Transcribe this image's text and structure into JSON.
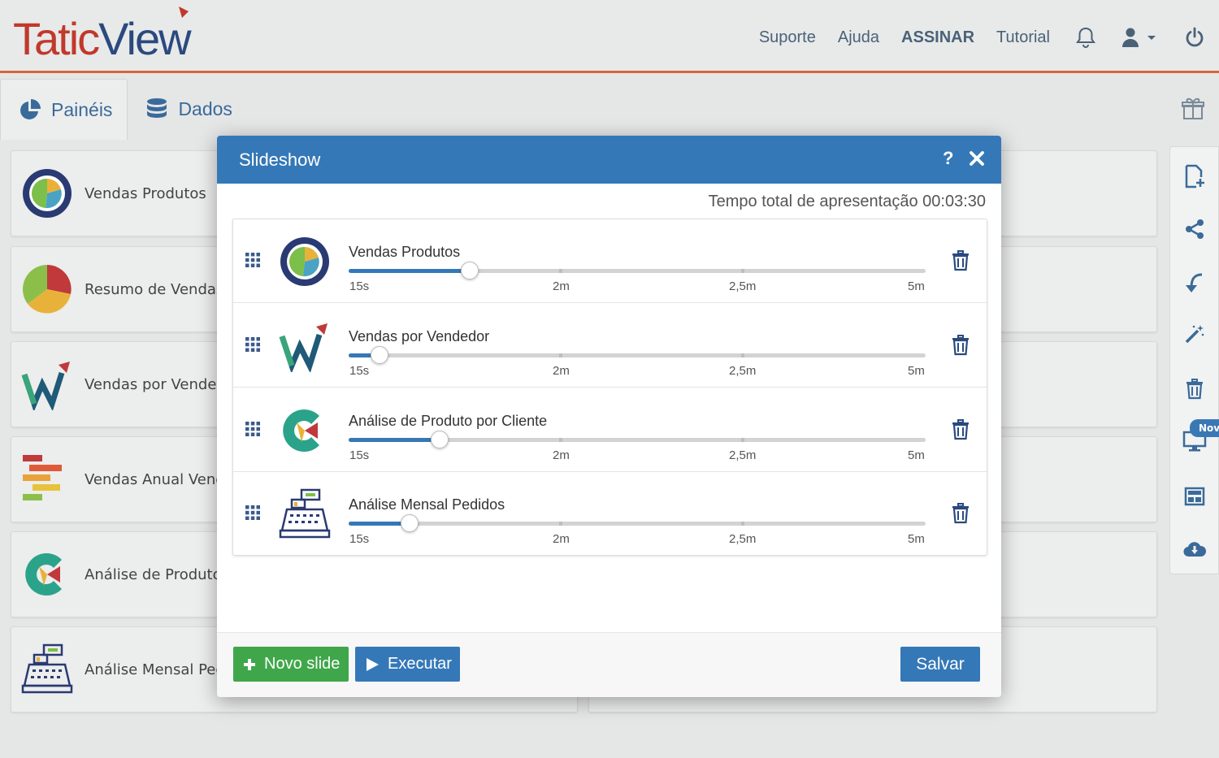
{
  "header": {
    "logo_part1": "Tatic",
    "logo_part2": "View",
    "nav": {
      "suporte": "Suporte",
      "ajuda": "Ajuda",
      "assinar": "ASSINAR",
      "tutorial": "Tutorial"
    }
  },
  "tabs": {
    "paineis": "Painéis",
    "dados": "Dados"
  },
  "cards": [
    "Vendas Produtos",
    "Resumo de Vendas",
    "Vendas por Vendedo",
    "Vendas Anual Vende",
    "Análise de Produto p",
    "Análise Mensal Pedid"
  ],
  "toolbar": {
    "new_badge": "Nov"
  },
  "modal": {
    "title": "Slideshow",
    "help": "?",
    "total_time": "Tempo total de apresentação 00:03:30",
    "slides": [
      {
        "title": "Vendas Produtos",
        "duration_fraction": 0.21
      },
      {
        "title": "Vendas por Vendedor",
        "duration_fraction": 0.053
      },
      {
        "title": "Análise de Produto por Cliente",
        "duration_fraction": 0.158
      },
      {
        "title": "Análise Mensal Pedidos",
        "duration_fraction": 0.105
      }
    ],
    "scale_labels": [
      "15s",
      "2m",
      "2,5m",
      "5m"
    ],
    "buttons": {
      "new_slide": "Novo slide",
      "run": "Executar",
      "save": "Salvar"
    }
  },
  "colors": {
    "accent": "#3578b7",
    "green": "#3fa74a",
    "header_line": "#d8643e"
  }
}
